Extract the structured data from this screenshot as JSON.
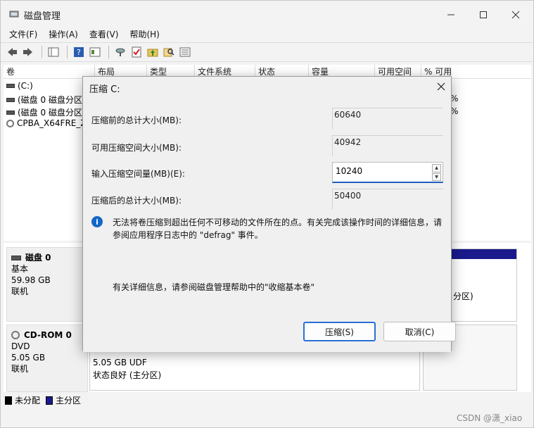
{
  "window": {
    "title": "磁盘管理"
  },
  "menu": {
    "items": [
      "文件(F)",
      "操作(A)",
      "查看(V)",
      "帮助(H)"
    ]
  },
  "volume_list": {
    "columns": [
      "卷",
      "布局",
      "类型",
      "文件系统",
      "状态",
      "容量",
      "可用空间",
      "% 可用"
    ],
    "rows": [
      {
        "name": "(C:)",
        "pct_fragment": ""
      },
      {
        "name": "(磁盘 0 磁盘分区",
        "pct_fragment": "%"
      },
      {
        "name": "(磁盘 0 磁盘分区",
        "pct_fragment": "%"
      },
      {
        "name": "CPBA_X64FRE_Z",
        "pct_fragment": ""
      }
    ]
  },
  "diskmap": {
    "disk0": {
      "name": "磁盘 0",
      "type": "基本",
      "size": "59.98 GB",
      "status": "联机",
      "partition_fragment": "分区)"
    },
    "cdrom0": {
      "name": "CD-ROM 0",
      "type": "DVD",
      "size": "5.05 GB",
      "status": "联机",
      "part_size": "5.05 GB UDF",
      "part_status": "状态良好 (主分区)"
    }
  },
  "legend": {
    "unallocated": "未分配",
    "primary": "主分区",
    "unallocated_color": "#000000",
    "primary_color": "#1a1a8c"
  },
  "dialog": {
    "title": "压缩 C:",
    "total_before_label": "压缩前的总计大小(MB):",
    "total_before_value": "60640",
    "available_label": "可用压缩空间大小(MB):",
    "available_value": "40942",
    "input_label": "输入压缩空间量(MB)(E):",
    "input_value": "10240",
    "total_after_label": "压缩后的总计大小(MB):",
    "total_after_value": "50400",
    "info_text": "无法将卷压缩到超出任何不可移动的文件所在的点。有关完成该操作时间的详细信息，请参阅应用程序日志中的 \"defrag\" 事件。",
    "help_text": "有关详细信息，请参阅磁盘管理帮助中的\"收缩基本卷\"",
    "shrink_button": "压缩(S)",
    "cancel_button": "取消(C)"
  },
  "watermark": "CSDN @潇_xiao"
}
